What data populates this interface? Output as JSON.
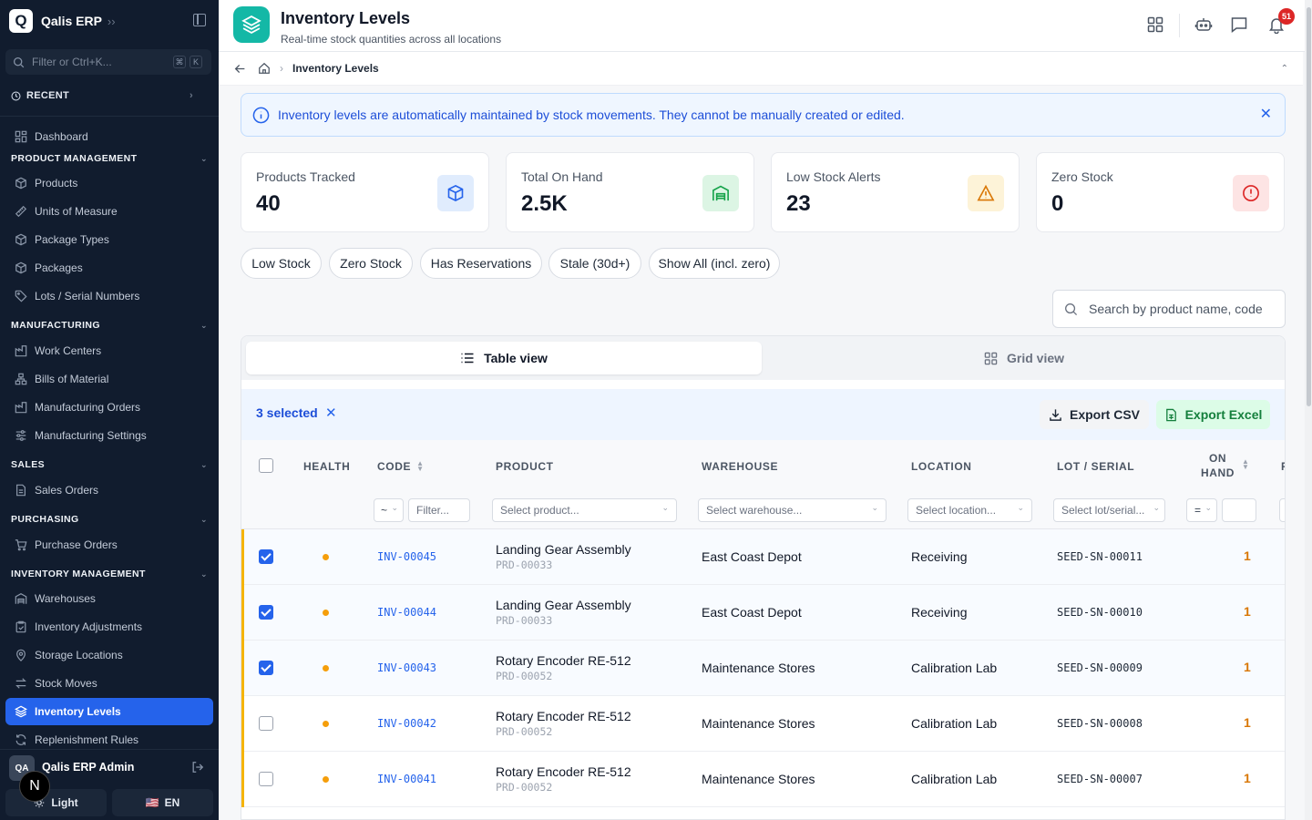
{
  "app": {
    "name": "Qalis ERP",
    "logo_letter": "Q"
  },
  "sidebar": {
    "search_placeholder": "Filter or Ctrl+K...",
    "search_kbd": [
      "⌘",
      "K"
    ],
    "recent_label": "RECENT",
    "dashboard": "Dashboard",
    "sections": [
      {
        "title": "PRODUCT MANAGEMENT",
        "items": [
          "Products",
          "Units of Measure",
          "Package Types",
          "Packages",
          "Lots / Serial Numbers"
        ]
      },
      {
        "title": "MANUFACTURING",
        "items": [
          "Work Centers",
          "Bills of Material",
          "Manufacturing Orders",
          "Manufacturing Settings"
        ]
      },
      {
        "title": "SALES",
        "items": [
          "Sales Orders"
        ]
      },
      {
        "title": "PURCHASING",
        "items": [
          "Purchase Orders"
        ]
      },
      {
        "title": "INVENTORY MANAGEMENT",
        "items": [
          "Warehouses",
          "Inventory Adjustments",
          "Storage Locations",
          "Stock Moves",
          "Inventory Levels",
          "Replenishment Rules"
        ]
      }
    ],
    "active_item": "Inventory Levels",
    "user": {
      "initials": "QA",
      "name": "Qalis ERP Admin"
    },
    "theme_label": "Light",
    "lang_flag": "🇺🇸",
    "lang_label": "EN",
    "overlay_badge": "N"
  },
  "header": {
    "title": "Inventory Levels",
    "subtitle": "Real-time stock quantities across all locations",
    "notification_count": "51"
  },
  "breadcrumb": {
    "current": "Inventory Levels"
  },
  "banner": {
    "text": "Inventory levels are automatically maintained by stock movements. They cannot be manually created or edited."
  },
  "stats": [
    {
      "label": "Products Tracked",
      "value": "40",
      "icon": "box-icon",
      "color": "#2563eb",
      "bg": "#e0ecfd"
    },
    {
      "label": "Total On Hand",
      "value": "2.5K",
      "icon": "warehouse-icon",
      "color": "#16a34a",
      "bg": "#dcf5e4"
    },
    {
      "label": "Low Stock Alerts",
      "value": "23",
      "icon": "warning-icon",
      "color": "#d97706",
      "bg": "#fdf3d8"
    },
    {
      "label": "Zero Stock",
      "value": "0",
      "icon": "alert-circle-icon",
      "color": "#dc2626",
      "bg": "#fde4e4"
    }
  ],
  "filters": [
    "Low Stock",
    "Zero Stock",
    "Has Reservations",
    "Stale (30d+)",
    "Show All (incl. zero)"
  ],
  "search": {
    "placeholder": "Search by product name, code..."
  },
  "views": {
    "table": "Table view",
    "grid": "Grid view"
  },
  "bulk": {
    "selected": "3 selected",
    "export_csv": "Export CSV",
    "export_excel": "Export Excel"
  },
  "table": {
    "columns": {
      "health": "HEALTH",
      "code": "CODE",
      "product": "PRODUCT",
      "warehouse": "WAREHOUSE",
      "location": "LOCATION",
      "lot": "LOT / SERIAL",
      "on_hand_1": "ON",
      "on_hand_2": "HAND",
      "next": "R"
    },
    "filters": {
      "code_op": "~",
      "code_filter": "Filter...",
      "product": "Select product...",
      "warehouse": "Select warehouse...",
      "location": "Select location...",
      "lot": "Select lot/serial...",
      "qty_op": "="
    },
    "rows": [
      {
        "code": "INV-00045",
        "product": "Landing Gear Assembly",
        "product_code": "PRD-00033",
        "warehouse": "East Coast Depot",
        "location": "Receiving",
        "lot": "SEED-SN-00011",
        "qty": "1",
        "selected": true
      },
      {
        "code": "INV-00044",
        "product": "Landing Gear Assembly",
        "product_code": "PRD-00033",
        "warehouse": "East Coast Depot",
        "location": "Receiving",
        "lot": "SEED-SN-00010",
        "qty": "1",
        "selected": true
      },
      {
        "code": "INV-00043",
        "product": "Rotary Encoder RE-512",
        "product_code": "PRD-00052",
        "warehouse": "Maintenance Stores",
        "location": "Calibration Lab",
        "lot": "SEED-SN-00009",
        "qty": "1",
        "selected": true
      },
      {
        "code": "INV-00042",
        "product": "Rotary Encoder RE-512",
        "product_code": "PRD-00052",
        "warehouse": "Maintenance Stores",
        "location": "Calibration Lab",
        "lot": "SEED-SN-00008",
        "qty": "1",
        "selected": false
      },
      {
        "code": "INV-00041",
        "product": "Rotary Encoder RE-512",
        "product_code": "PRD-00052",
        "warehouse": "Maintenance Stores",
        "location": "Calibration Lab",
        "lot": "SEED-SN-00007",
        "qty": "1",
        "selected": false
      }
    ]
  }
}
